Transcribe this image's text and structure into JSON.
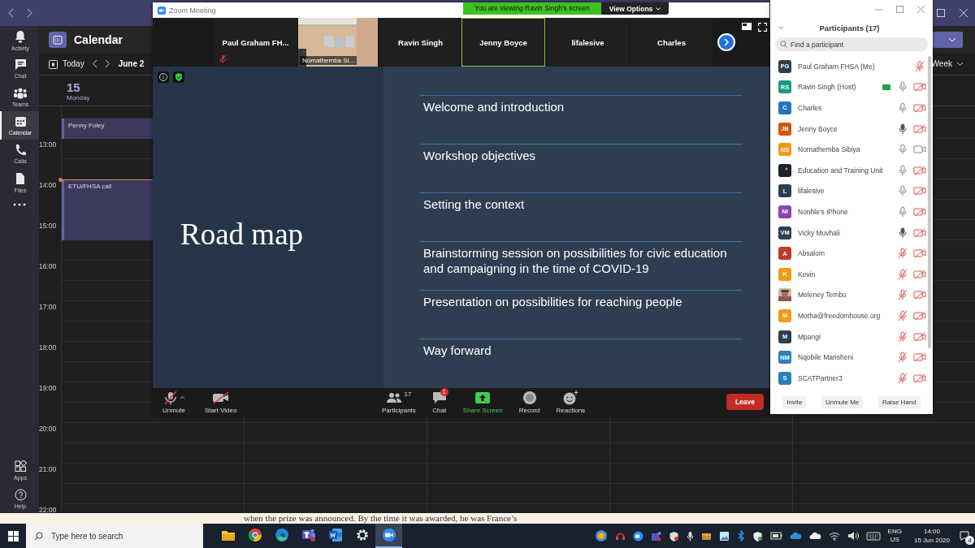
{
  "teams": {
    "rail": [
      {
        "label": "Activity",
        "selected": false
      },
      {
        "label": "Chat",
        "selected": false
      },
      {
        "label": "Teams",
        "selected": false
      },
      {
        "label": "Calendar",
        "selected": true
      },
      {
        "label": "Calls",
        "selected": false
      },
      {
        "label": "Files",
        "selected": false
      }
    ],
    "rail_bottom": [
      {
        "label": "Apps"
      },
      {
        "label": "Help"
      }
    ],
    "title": "Calendar",
    "today": "Today",
    "month": "June 2",
    "view": "Week",
    "day": {
      "date": "15",
      "weekday": "Monday"
    },
    "times": [
      "13:00",
      "14:00",
      "15:00",
      "16:00",
      "17:00",
      "18:00",
      "19:00",
      "20:00",
      "21:00",
      "22:00"
    ],
    "events": [
      {
        "title": "Penny Foley"
      },
      {
        "title": "ETU/FHSA call"
      }
    ]
  },
  "zoom": {
    "title": "Zoom Meeting",
    "banner": "You are viewing Ravin Singh's screen",
    "view_options": "View Options",
    "tiles": [
      {
        "kind": "empty"
      },
      {
        "kind": "name",
        "name": "Paul Graham FH...",
        "muted": true,
        "active": false
      },
      {
        "kind": "video",
        "name": "Nomathemba Si..."
      },
      {
        "kind": "name",
        "name": "Ravin Singh",
        "muted": false,
        "active": false
      },
      {
        "kind": "name",
        "name": "Jenny Boyce",
        "muted": false,
        "active": true
      },
      {
        "kind": "name",
        "name": "lifalesive",
        "muted": false,
        "active": false
      },
      {
        "kind": "name",
        "name": "Charles",
        "muted": false,
        "active": false
      }
    ],
    "slide": {
      "title": "Road map",
      "items": [
        "Welcome and introduction",
        "Workshop objectives",
        "Setting the context",
        "Brainstorming session on possibilities for civic education and campaigning in the time of COVID-19",
        "Presentation on possibilities for reaching people",
        "Way forward"
      ]
    },
    "toolbar_left": [
      {
        "label": "Unmute",
        "kind": "audio"
      },
      {
        "label": "Start Video",
        "kind": "video"
      }
    ],
    "toolbar_mid": [
      {
        "label": "Participants",
        "kind": "participants",
        "count": "17"
      },
      {
        "label": "Chat",
        "kind": "chat",
        "badge": "1"
      },
      {
        "label": "Share Screen",
        "kind": "share"
      },
      {
        "label": "Record",
        "kind": "record"
      },
      {
        "label": "Reactions",
        "kind": "reactions"
      }
    ],
    "leave": "Leave"
  },
  "participants": {
    "title": "Participants (17)",
    "search_placeholder": "Find a participant",
    "rows": [
      {
        "name": "Paul Graham FHSA (Me)",
        "avatar": {
          "initials": "PG",
          "color": "#2d3e50"
        },
        "muted": true,
        "speaking": false
      },
      {
        "name": "Ravin Singh (Host)",
        "avatar": {
          "initials": "RS",
          "color": "#1a9c84"
        },
        "sharing": true,
        "muted": false,
        "speaking": false,
        "camera_on": false
      },
      {
        "name": "Charles",
        "avatar": {
          "initials": "C",
          "color": "#2175c0"
        },
        "muted": false,
        "speaking": false,
        "camera_on": false
      },
      {
        "name": "Jenny Boyce",
        "avatar": {
          "initials": "JB",
          "color": "#d0570f"
        },
        "muted": false,
        "speaking": true,
        "camera_on": false
      },
      {
        "name": "Nomathemba Sibiya",
        "avatar": {
          "initials": "NS",
          "color": "#f0981a"
        },
        "muted": false,
        "speaking": false,
        "camera_on": true
      },
      {
        "name": "Education and Training Unit",
        "avatar": {
          "kind": "logo"
        },
        "muted": false,
        "speaking": false,
        "camera_on": false
      },
      {
        "name": "lifalesive",
        "avatar": {
          "initials": "L",
          "color": "#2d3e50"
        },
        "muted": false,
        "speaking": false,
        "camera_on": false
      },
      {
        "name": "Nonhle's iPhone",
        "avatar": {
          "initials": "NI",
          "color": "#8e44ad"
        },
        "muted": false,
        "speaking": false,
        "camera_on": false
      },
      {
        "name": "Vicky Muvhali",
        "avatar": {
          "initials": "VM",
          "color": "#2d3e50"
        },
        "muted": false,
        "speaking": true,
        "camera_on": false
      },
      {
        "name": "Absalom",
        "avatar": {
          "initials": "A",
          "color": "#c0392b"
        },
        "muted": true,
        "speaking": false,
        "camera_on": false
      },
      {
        "name": "Kevin",
        "avatar": {
          "initials": "K",
          "color": "#f39c12"
        },
        "muted": true,
        "speaking": false,
        "camera_on": false
      },
      {
        "name": "Meleney Tembo",
        "muted": true,
        "speaking": false,
        "camera_on": false
      },
      {
        "name": "Motha@freedomhouse.org",
        "avatar": {
          "initials": "M",
          "color": "#f39c12"
        },
        "muted": true,
        "speaking": false,
        "camera_on": false
      },
      {
        "name": "Mpangi",
        "avatar": {
          "initials": "M",
          "color": "#2d3e50"
        },
        "muted": true,
        "speaking": false,
        "camera_on": false
      },
      {
        "name": "Nqobile Marisheni",
        "avatar": {
          "initials": "NM",
          "color": "#2980b9"
        },
        "muted": true,
        "speaking": false,
        "camera_on": false
      },
      {
        "name": "SCATPartner3",
        "avatar": {
          "initials": "S",
          "color": "#2980b9"
        },
        "muted": true,
        "speaking": false,
        "camera_on": false
      }
    ],
    "buttons": [
      "Invite",
      "Unmute Me",
      "Raise Hand"
    ]
  },
  "background_text": "when the prize was announced. By the time it was awarded, he was France’s",
  "taskbar": {
    "search_placeholder": "Type here to search",
    "apps": [
      {
        "active": false
      },
      {
        "active": false
      },
      {
        "active": false
      },
      {
        "active": false
      },
      {
        "active": false
      },
      {
        "active": false
      },
      {
        "active": true
      }
    ],
    "lang": "ENG",
    "region": "US",
    "time": "14:00",
    "date": "15 Jun 2020",
    "notifications": "4"
  }
}
